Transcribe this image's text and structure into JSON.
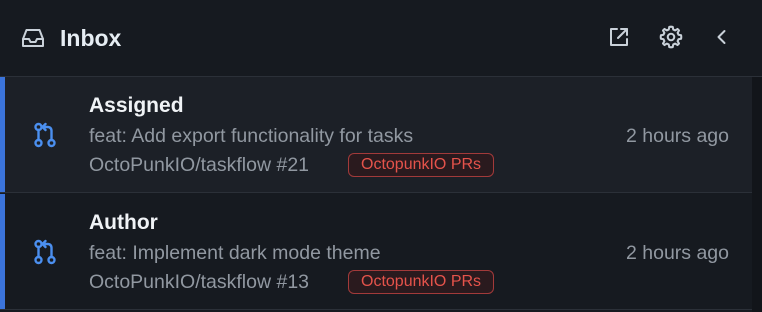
{
  "header": {
    "title": "Inbox",
    "icons": {
      "inbox": "inbox-icon",
      "open_external": "external-link-icon",
      "settings": "gear-icon",
      "collapse": "chevron-left-icon"
    }
  },
  "notifications": [
    {
      "reason": "Assigned",
      "subject": "feat: Add export functionality for tasks",
      "repo": "OctoPunkIO/taskflow #21",
      "label": "OctopunkIO PRs",
      "time": "2 hours ago",
      "icon": "pull-request-icon"
    },
    {
      "reason": "Author",
      "subject": "feat: Implement dark mode theme",
      "repo": "OctoPunkIO/taskflow #13",
      "label": "OctopunkIO PRs",
      "time": "2 hours ago",
      "icon": "pull-request-icon"
    }
  ],
  "colors": {
    "background": "#161a20",
    "accent": "#3b74db",
    "label_text": "#e5534b",
    "label_border": "#a23a3a",
    "muted_text": "#9198a1"
  }
}
